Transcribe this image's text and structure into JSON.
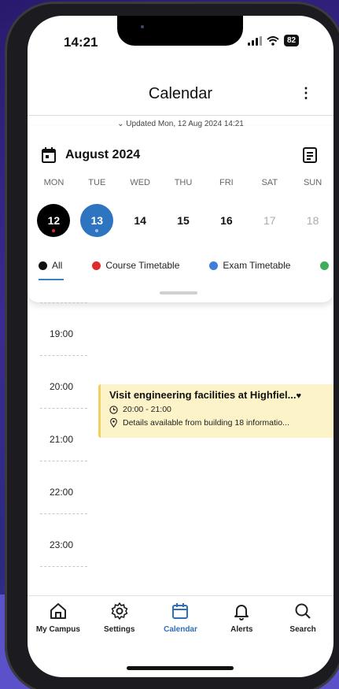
{
  "status": {
    "time": "14:21",
    "battery": "82"
  },
  "header": {
    "title": "Calendar",
    "updated": "Updated Mon, 12 Aug 2024 14:21"
  },
  "month": {
    "label": "August 2024"
  },
  "weekdays": [
    "MON",
    "TUE",
    "WED",
    "THU",
    "FRI",
    "SAT",
    "SUN"
  ],
  "dates": [
    "12",
    "13",
    "14",
    "15",
    "16",
    "17",
    "18"
  ],
  "filters": [
    {
      "label": "All",
      "color": "#111111"
    },
    {
      "label": "Course Timetable",
      "color": "#e02b2b"
    },
    {
      "label": "Exam Timetable",
      "color": "#3d7fd9"
    },
    {
      "label": "",
      "color": "#3fae5a"
    }
  ],
  "hours": [
    "19:00",
    "20:00",
    "21:00",
    "22:00",
    "23:00"
  ],
  "event": {
    "title": "Visit engineering facilities at Highfiel...",
    "time": "20:00 - 21:00",
    "location": "Details available from building 18 informatio..."
  },
  "nav": [
    {
      "label": "My Campus",
      "icon": "home-icon"
    },
    {
      "label": "Settings",
      "icon": "gear-icon"
    },
    {
      "label": "Calendar",
      "icon": "calendar-icon"
    },
    {
      "label": "Alerts",
      "icon": "bell-icon"
    },
    {
      "label": "Search",
      "icon": "search-icon"
    }
  ],
  "colors": {
    "accent": "#2f6fb7",
    "today": "#2f74c0",
    "selected": "#000000",
    "event_bg": "#fdf3c8"
  }
}
